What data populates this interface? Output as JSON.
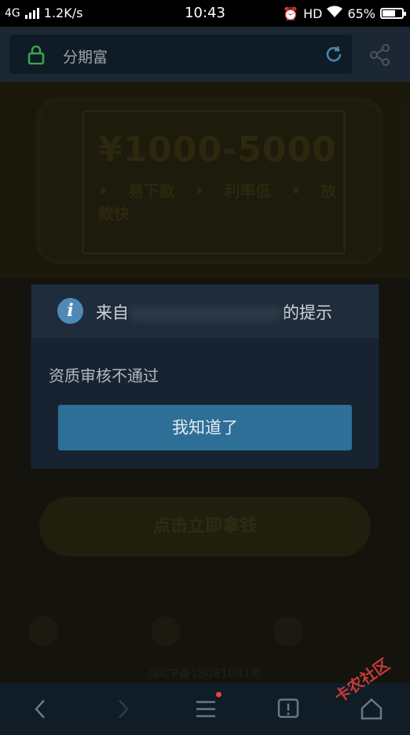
{
  "status_bar": {
    "network": "4G",
    "speed": "1.2K/s",
    "time": "10:43",
    "hd": "HD",
    "battery_text": "65%",
    "battery_level": 0.65
  },
  "browser": {
    "url_text": "分期富"
  },
  "page": {
    "price": "¥1000-5000",
    "features": "• 易下款 • 利率低 • 放款快",
    "cta_label": "点击立即拿钱",
    "icp": "闽ICP备18081081号"
  },
  "dialog": {
    "title_prefix": "来自",
    "title_suffix": "的提示",
    "message": "资质审核不通过",
    "button_label": "我知道了"
  },
  "watermark": "卡农社区",
  "colors": {
    "dialog_button": "#2e6f98",
    "info_icon": "#4f89b8",
    "lock_icon": "#3fa34d",
    "reload_icon": "#4a87b0"
  }
}
